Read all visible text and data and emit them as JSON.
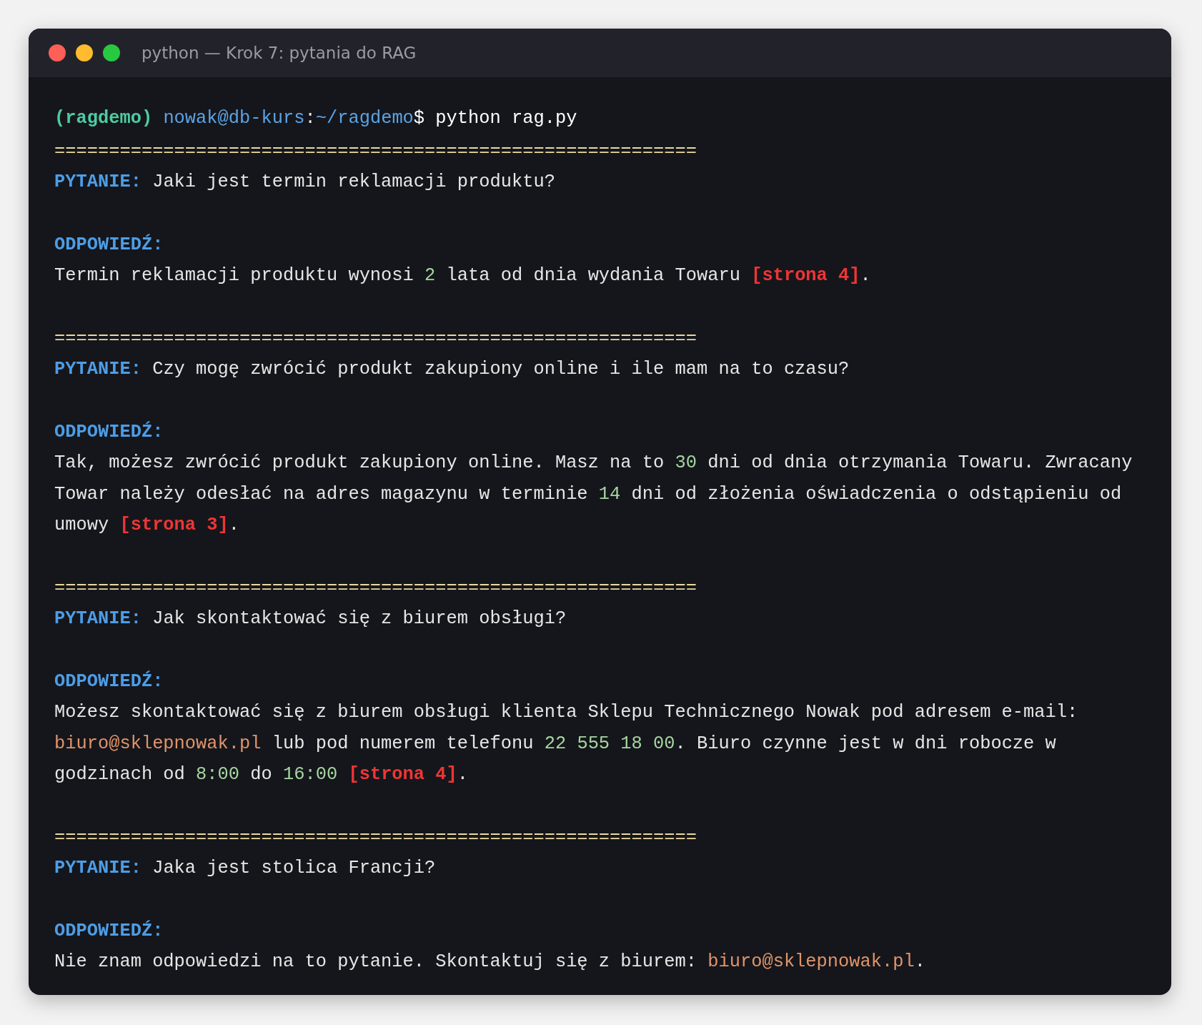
{
  "window": {
    "title": "python — Krok 7: pytania do RAG",
    "buttons": [
      {
        "kind": "close"
      },
      {
        "kind": "minimize"
      },
      {
        "kind": "zoom"
      }
    ]
  },
  "prompt": [
    {
      "text": "(ragdemo) ",
      "kind": "env"
    },
    {
      "text": "nowak@db-kurs",
      "kind": "path"
    },
    {
      "text": ":",
      "kind": "plain"
    },
    {
      "text": "~/ragdemo",
      "kind": "path"
    },
    {
      "text": "$ python rag.py",
      "kind": "command"
    }
  ],
  "blocks": [
    {
      "rule": "===========================================================",
      "question": {
        "label": "PYTANIE:",
        "text": "Jaki jest termin reklamacji produktu?"
      },
      "answer": {
        "label": "ODPOWIEDŹ:",
        "segments": [
          {
            "text": "Termin reklamacji produktu wynosi ",
            "kind": "plain"
          },
          {
            "text": "2",
            "kind": "number"
          },
          {
            "text": " lata od dnia wydania Towaru ",
            "kind": "plain"
          },
          {
            "text": "[strona 4]",
            "kind": "citation"
          },
          {
            "text": ".",
            "kind": "plain"
          }
        ]
      }
    },
    {
      "rule": "===========================================================",
      "question": {
        "label": "PYTANIE:",
        "text": "Czy mogę zwrócić produkt zakupiony online i ile mam na to czasu?"
      },
      "answer": {
        "label": "ODPOWIEDŹ:",
        "segments": [
          {
            "text": "Tak, możesz zwrócić produkt zakupiony online. Masz na to ",
            "kind": "plain"
          },
          {
            "text": "30",
            "kind": "number"
          },
          {
            "text": " dni od dnia otrzymania Towaru. Zwracany Towar należy odesłać na adres magazynu w terminie ",
            "kind": "plain"
          },
          {
            "text": "14",
            "kind": "number"
          },
          {
            "text": " dni od złożenia oświadczenia o odstąpieniu od umowy ",
            "kind": "plain"
          },
          {
            "text": "[strona 3]",
            "kind": "citation"
          },
          {
            "text": ".",
            "kind": "plain"
          }
        ]
      }
    },
    {
      "rule": "===========================================================",
      "question": {
        "label": "PYTANIE:",
        "text": "Jak skontaktować się z biurem obsługi?"
      },
      "answer": {
        "label": "ODPOWIEDŹ:",
        "segments": [
          {
            "text": "Możesz skontaktować się z biurem obsługi klienta Sklepu Technicznego Nowak pod adresem e-mail: ",
            "kind": "plain"
          },
          {
            "text": "biuro@sklepnowak.pl",
            "kind": "email"
          },
          {
            "text": " lub pod numerem telefonu ",
            "kind": "plain"
          },
          {
            "text": "22 555 18 00",
            "kind": "number"
          },
          {
            "text": ". Biuro czynne jest w dni robocze w godzinach od ",
            "kind": "plain"
          },
          {
            "text": "8:00",
            "kind": "number"
          },
          {
            "text": " do ",
            "kind": "plain"
          },
          {
            "text": "16:00",
            "kind": "number"
          },
          {
            "text": " [strona 4]",
            "kind": "citation"
          },
          {
            "text": ".",
            "kind": "plain"
          }
        ]
      }
    },
    {
      "rule": "===========================================================",
      "question": {
        "label": "PYTANIE:",
        "text": "Jaka jest stolica Francji?"
      },
      "answer": {
        "label": "ODPOWIEDŹ:",
        "segments": [
          {
            "text": "Nie znam odpowiedzi na to pytanie. Skontaktuj się z biurem: ",
            "kind": "plain"
          },
          {
            "text": "biuro@sklepnowak.pl",
            "kind": "email"
          },
          {
            "text": ".",
            "kind": "plain"
          }
        ]
      }
    }
  ]
}
